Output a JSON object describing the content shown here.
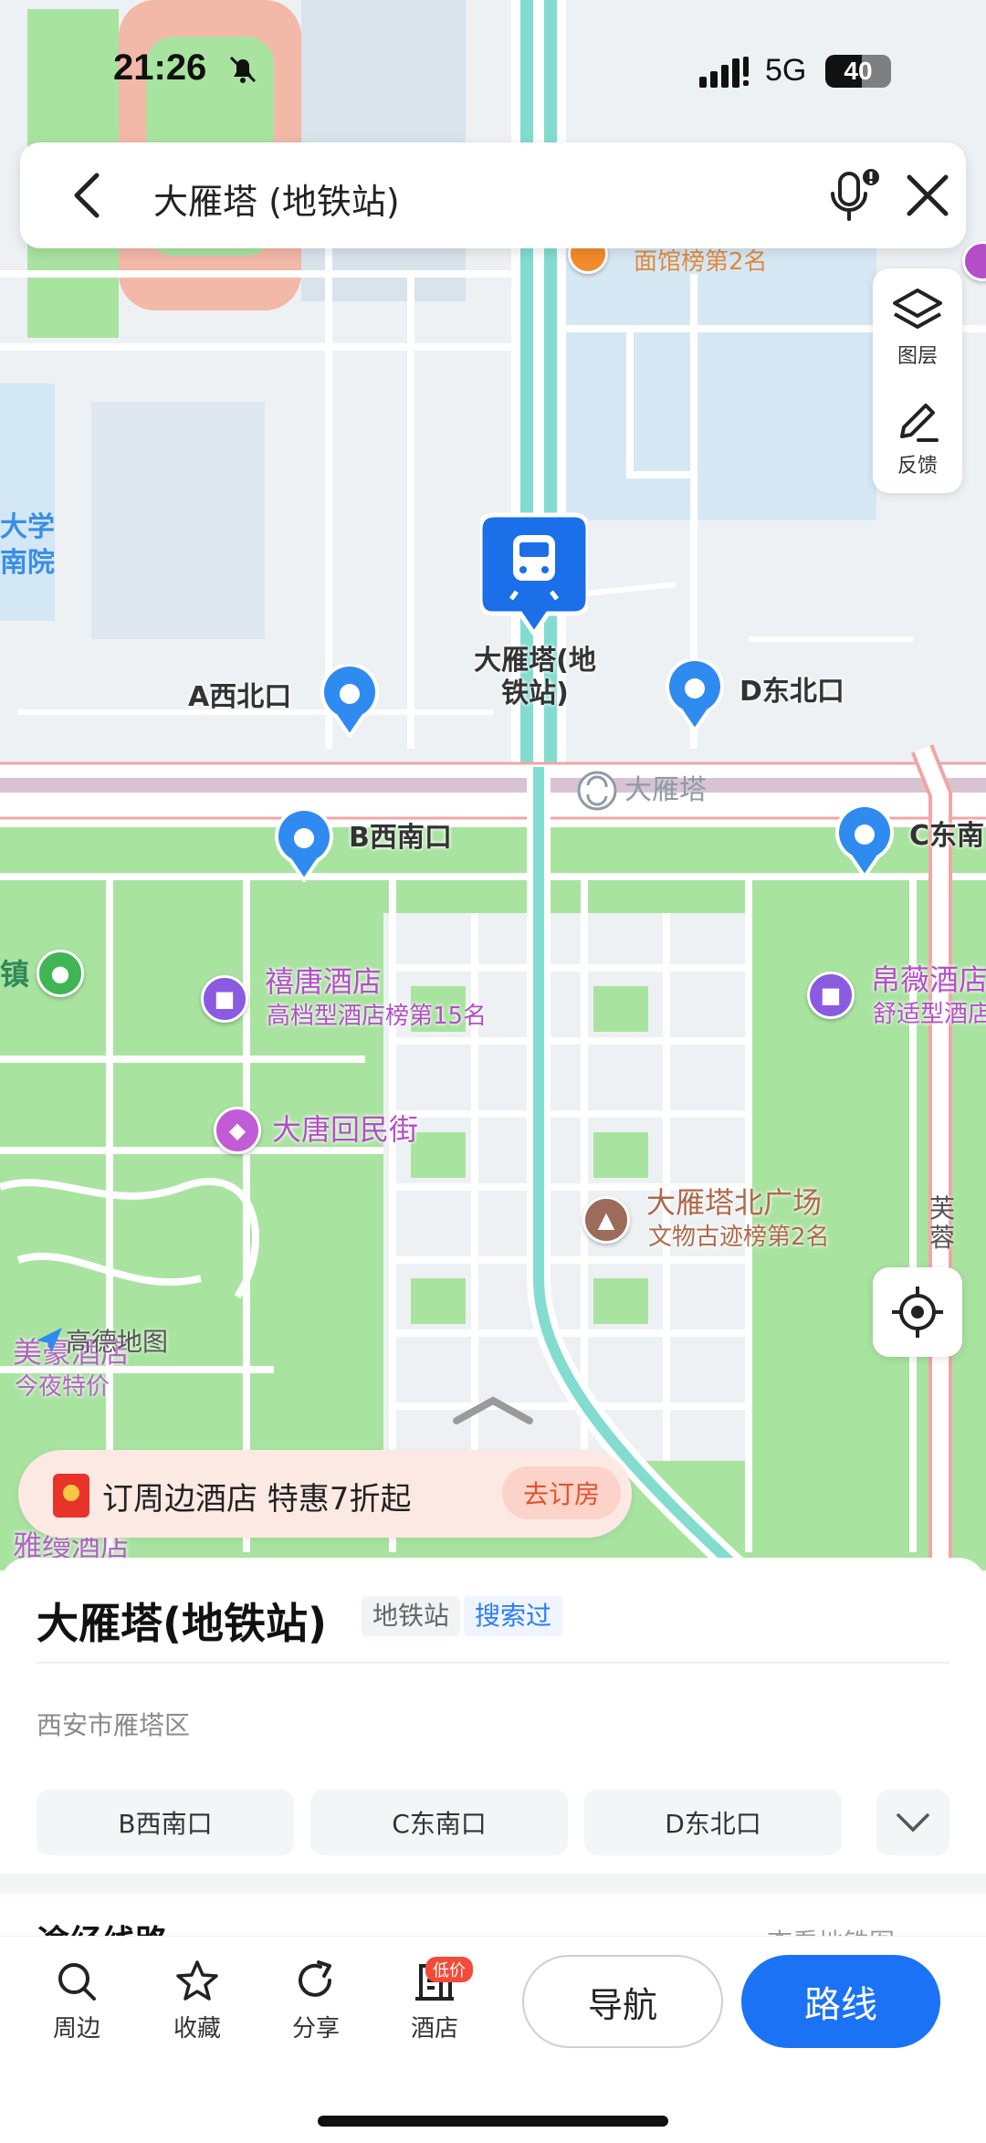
{
  "status_bar": {
    "time": "21:26",
    "network": "5G",
    "battery": "40"
  },
  "search": {
    "query": "大雁塔 (地铁站)"
  },
  "tools": {
    "layers": "图层",
    "feedback": "反馈"
  },
  "map": {
    "station_name": "大雁塔(地\n铁站)",
    "line_station": "大雁塔",
    "exits": {
      "a": "A西北口",
      "b": "B西南口",
      "c": "C东南",
      "d": "D东北口"
    },
    "pois": {
      "university": "大学\n南院",
      "noodle_rank": "面馆榜第2名",
      "town": "镇",
      "hotel1_name": "禧唐酒店",
      "hotel1_sub": "高档型酒店榜第15名",
      "hotel2_name": "帛薇酒店",
      "hotel2_sub": "舒适型酒店",
      "street": "大唐回民街",
      "plaza_name": "大雁塔北广场",
      "plaza_sub": "文物古迹榜第2名",
      "road": "芙\n蓉\n\n路",
      "hotel3_name": "美豪酒店",
      "hotel3_sub": "今夜特价",
      "hotel4_name": "雅缦酒店"
    },
    "logo": "高德地图",
    "colors": {
      "park": "#a9e3a0",
      "road": "#ffffff",
      "water": "#c8e2f5",
      "metro": "#82dccf",
      "pin": "#2f7cf6"
    }
  },
  "promo": {
    "text": "订周边酒店 特惠7折起",
    "cta": "去订房"
  },
  "sheet": {
    "title": "大雁塔(地铁站)",
    "tag_type": "地铁站",
    "tag_history": "搜索过",
    "district": "西安市雁塔区",
    "exit_chips": [
      "B西南口",
      "C东南口",
      "D东北口"
    ],
    "peek_title": "途经线路",
    "peek_right": "查看地铁图 >"
  },
  "actions": {
    "nearby": "周边",
    "favorite": "收藏",
    "share": "分享",
    "hotel": "酒店",
    "hotel_badge": "低价",
    "navigate": "导航",
    "route": "路线"
  }
}
